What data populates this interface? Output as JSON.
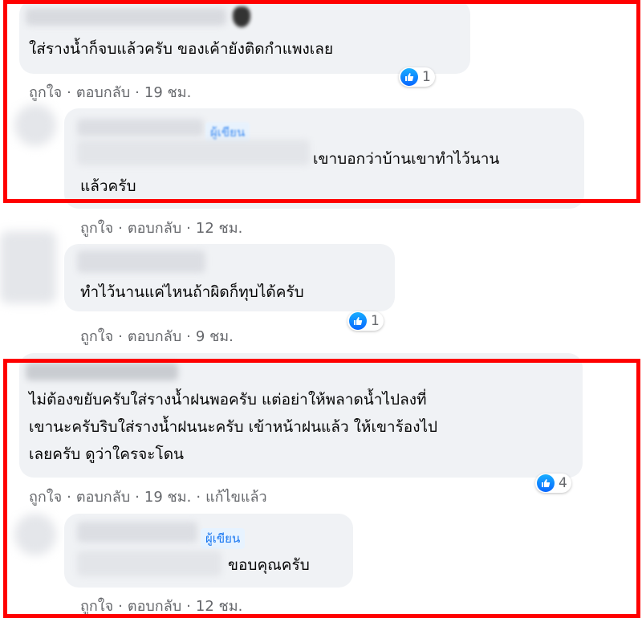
{
  "actions": {
    "like": "ถูกใจ",
    "reply": "ตอบกลับ",
    "separator": "·"
  },
  "author_badge": "ผู้เขียน",
  "comments": [
    {
      "text": [
        "ใส่รางน้ำก็จบแล้วครับ ของเค้ายังติดกำแพงเลย"
      ],
      "time": "19 ชม.",
      "reactions": "1"
    },
    {
      "text": [
        "เขาบอกว่าบ้านเขาทำไว้นาน",
        "แล้วครับ"
      ],
      "time": "12 ชม."
    },
    {
      "text": [
        "ทำไว้นานแค่ไหนถ้าผิดก็ทุบได้ครับ"
      ],
      "time": "9 ชม.",
      "reactions": "1"
    },
    {
      "text": [
        "ไม่ต้องขยับครับใส่รางน้ำฝนพอครับ แต่อย่าให้พลาดน้ำไปลงที่",
        "เขานะครับริบใส่รางน้ำฝนนะครับ เข้าหน้าฝนแล้ว ให้เขาร้องไป",
        "เลยครับ ดูว่าใครจะโดน"
      ],
      "time": "19 ชม.",
      "edited": "แก้ไขแล้ว",
      "reactions": "4"
    },
    {
      "text": [
        "ขอบคุณครับ"
      ],
      "time": "12 ชม."
    }
  ],
  "colors": {
    "highlight": "#ff0000",
    "bubble": "#f0f2f5",
    "meta": "#65676b",
    "like": "#0866ff"
  },
  "icons": [
    "like-icon"
  ]
}
